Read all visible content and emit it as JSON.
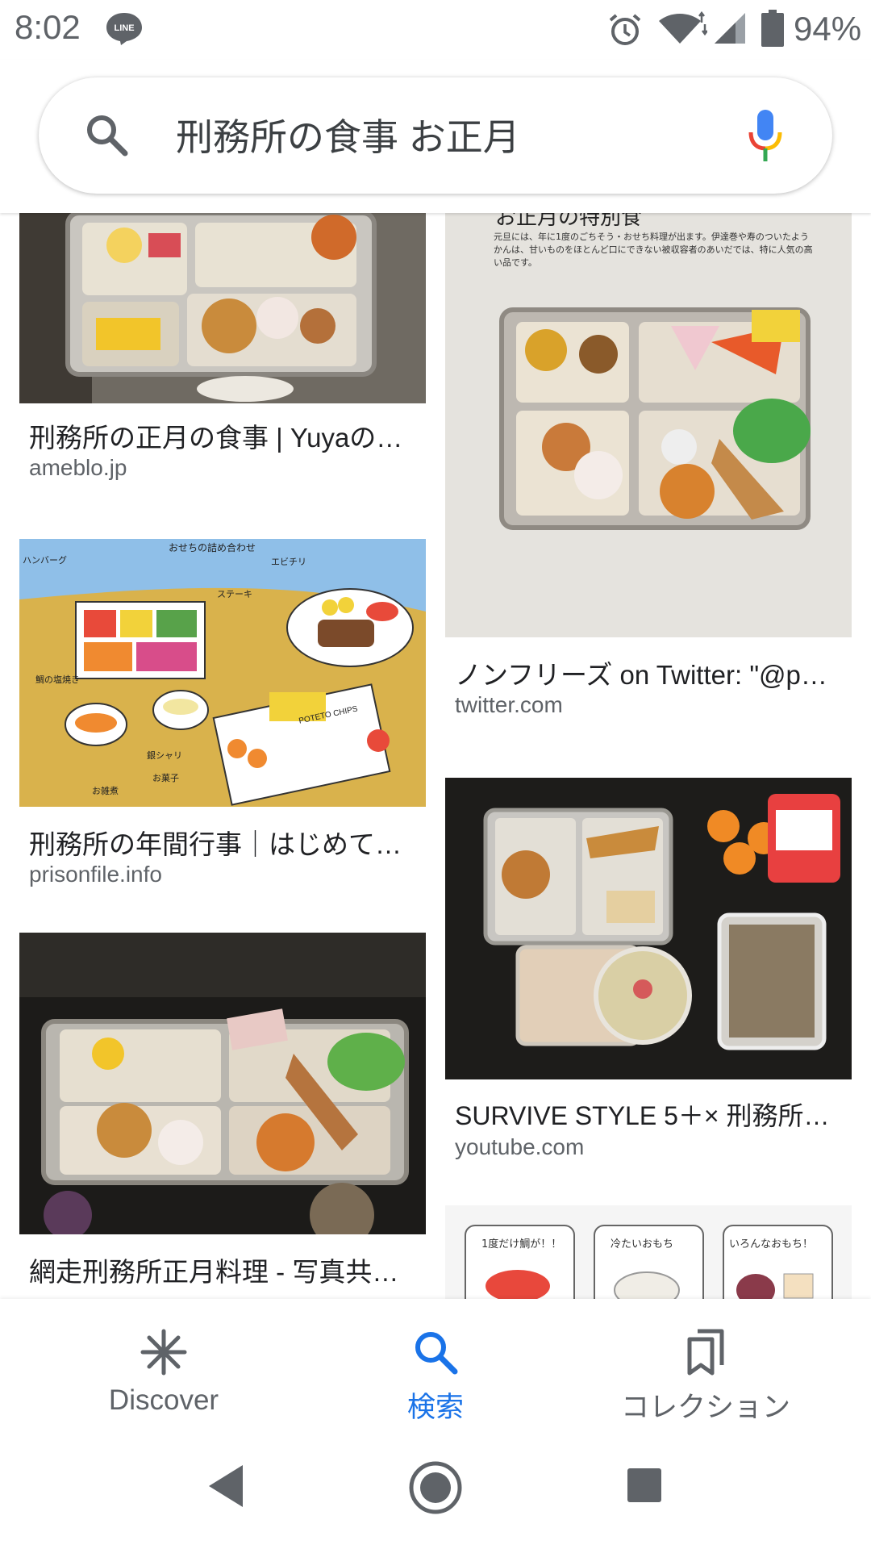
{
  "status_bar": {
    "time": "8:02",
    "battery_pct": "94%",
    "line_icon_label": "LINE",
    "icons": [
      "line-icon",
      "alarm-icon",
      "wifi-icon",
      "signal-icon",
      "battery-icon"
    ]
  },
  "search": {
    "query": "刑務所の食事 お正月",
    "icons": [
      "search-icon",
      "mic-icon"
    ]
  },
  "results": {
    "left": [
      {
        "title": "刑務所の正月の食事 | Yuyaの…",
        "source": "ameblo.jp"
      },
      {
        "title": "刑務所の年間行事｜はじめて…",
        "source": "prisonfile.info"
      },
      {
        "title": "網走刑務所正月料理 - 写真共…",
        "source": ""
      }
    ],
    "right": [
      {
        "title": "ノンフリーズ on Twitter: \"@p…",
        "source": "twitter.com"
      },
      {
        "title": "SURVIVE STYLE 5＋× 刑務所…",
        "source": "youtube.com"
      },
      {
        "title": "",
        "source": ""
      }
    ],
    "thumb_text": {
      "osechi_heading": "お正月の特別食",
      "osechi_caption": "元旦には、年に1度のごちそう・おせち料理が出ます。伊達巻や寿のついたようかんは、甘いものをほとんど口にできない被収容者のあいだでは、特に人気の高い品です。",
      "illus_labels": [
        "おせちの詰め合わせ",
        "ハンバーグ",
        "エビチリ",
        "ステーキ",
        "鯛の塩焼き",
        "銀シャリ",
        "お菓子",
        "お雑煮",
        "POTETO CHIPS"
      ],
      "mochi_labels": [
        "1度だけ鯛が！！",
        "冷たいおもち",
        "いろんなおもち！"
      ]
    }
  },
  "bottom_nav": {
    "items": [
      {
        "label": "Discover",
        "icon": "asterisk-icon"
      },
      {
        "label": "検索",
        "icon": "search-icon"
      },
      {
        "label": "コレクション",
        "icon": "bookmarks-icon"
      }
    ],
    "active_color": "#1a73e8"
  },
  "system_nav": {
    "icons": [
      "back-icon",
      "home-icon",
      "recents-icon"
    ]
  }
}
